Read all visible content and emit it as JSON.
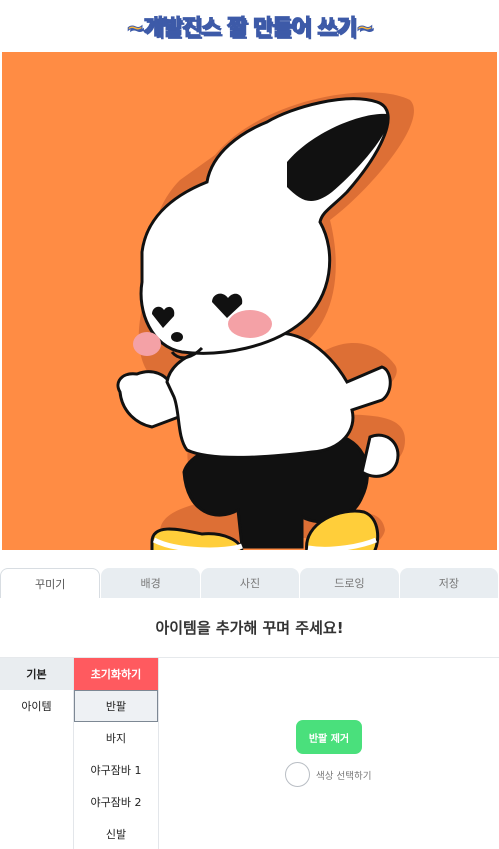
{
  "header": {
    "title": "~개발진스 짤 만들어 쓰기~"
  },
  "canvas": {
    "background_color": "#ff8c44",
    "image": "bunny-character-illustration"
  },
  "tabs": [
    {
      "label": "꾸미기",
      "active": true
    },
    {
      "label": "배경",
      "active": false
    },
    {
      "label": "사진",
      "active": false
    },
    {
      "label": "드로잉",
      "active": false
    },
    {
      "label": "저장",
      "active": false
    }
  ],
  "panel": {
    "title": "아이템을 추가해 꾸며 주세요!",
    "categories": [
      {
        "label": "기본",
        "active": true
      },
      {
        "label": "아이템",
        "active": false
      }
    ],
    "reset_label": "초기화하기",
    "items": [
      {
        "label": "반팔",
        "active": true
      },
      {
        "label": "바지",
        "active": false
      },
      {
        "label": "야구잠바 1",
        "active": false
      },
      {
        "label": "야구잠바 2",
        "active": false
      },
      {
        "label": "신발",
        "active": false
      }
    ],
    "remove_button_label": "반팔 제거",
    "color_select_label": "색상 선택하기"
  },
  "colors": {
    "reset": "#ff5a5f",
    "remove": "#4ae07c",
    "canvas_bg": "#ff8c44",
    "title_fill": "#f7b43c",
    "title_stroke": "#3d5aa8"
  }
}
